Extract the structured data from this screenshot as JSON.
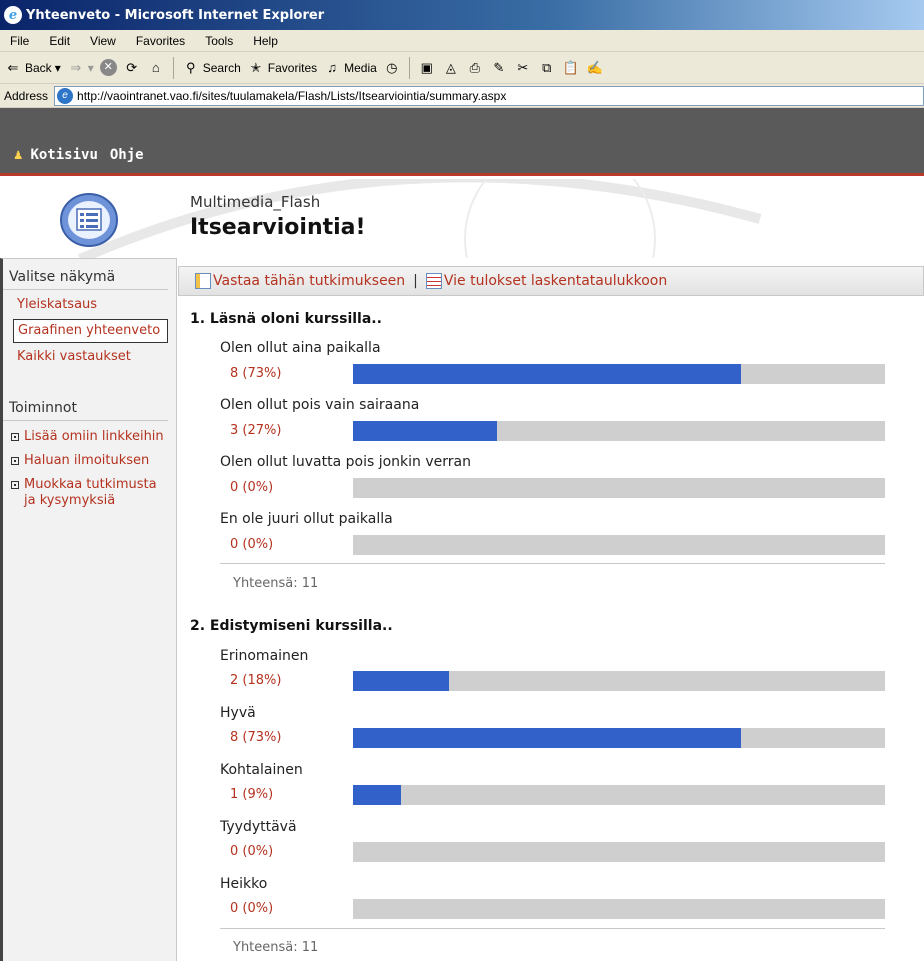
{
  "window": {
    "title": "Yhteenveto - Microsoft Internet Explorer"
  },
  "menu": [
    "File",
    "Edit",
    "View",
    "Favorites",
    "Tools",
    "Help"
  ],
  "toolbar": {
    "back": "Back",
    "search": "Search",
    "favorites": "Favorites",
    "media": "Media"
  },
  "address": {
    "label": "Address",
    "url": "http://vaointranet.vao.fi/sites/tuulamakela/Flash/Lists/Itsearviointia/summary.aspx"
  },
  "topnav": {
    "home": "Kotisivu",
    "help": "Ohje"
  },
  "header": {
    "site_name": "Multimedia_Flash",
    "page_title": "Itsearviointia!"
  },
  "sidebar": {
    "views_heading": "Valitse näkymä",
    "views": [
      {
        "label": "Yleiskatsaus",
        "active": false
      },
      {
        "label": "Graafinen yhteenveto",
        "active": true
      },
      {
        "label": "Kaikki vastaukset",
        "active": false
      }
    ],
    "actions_heading": "Toiminnot",
    "actions": [
      "Lisää omiin linkkeihin",
      "Haluan ilmoituksen",
      "Muokkaa tutkimusta ja kysymyksiä"
    ]
  },
  "actionbar": {
    "respond": "Vastaa tähän tutkimukseen",
    "separator": "|",
    "export": "Vie tulokset laskentataulukkoon"
  },
  "colors": {
    "bar_fill": "#3161c9",
    "bar_track": "#cfcfcf",
    "link": "#b4321f",
    "nav_accent": "#b8392a"
  },
  "questions": [
    {
      "title": "1. Läsnä oloni kurssilla..",
      "options": [
        {
          "label": "Olen ollut aina paikalla",
          "count": "8 (73%)",
          "fraction": 0.73
        },
        {
          "label": "Olen ollut pois vain sairaana",
          "count": "3 (27%)",
          "fraction": 0.27
        },
        {
          "label": "Olen ollut luvatta pois jonkin verran",
          "count": "0 (0%)",
          "fraction": 0
        },
        {
          "label": "En ole juuri ollut paikalla",
          "count": "0 (0%)",
          "fraction": 0
        }
      ],
      "total": "Yhteensä: 11"
    },
    {
      "title": "2. Edistymiseni kurssilla..",
      "options": [
        {
          "label": "Erinomainen",
          "count": "2 (18%)",
          "fraction": 0.18
        },
        {
          "label": "Hyvä",
          "count": "8 (73%)",
          "fraction": 0.73
        },
        {
          "label": "Kohtalainen",
          "count": "1 (9%)",
          "fraction": 0.09
        },
        {
          "label": "Tyydyttävä",
          "count": "0 (0%)",
          "fraction": 0
        },
        {
          "label": "Heikko",
          "count": "0 (0%)",
          "fraction": 0
        }
      ],
      "total": "Yhteensä: 11"
    }
  ]
}
